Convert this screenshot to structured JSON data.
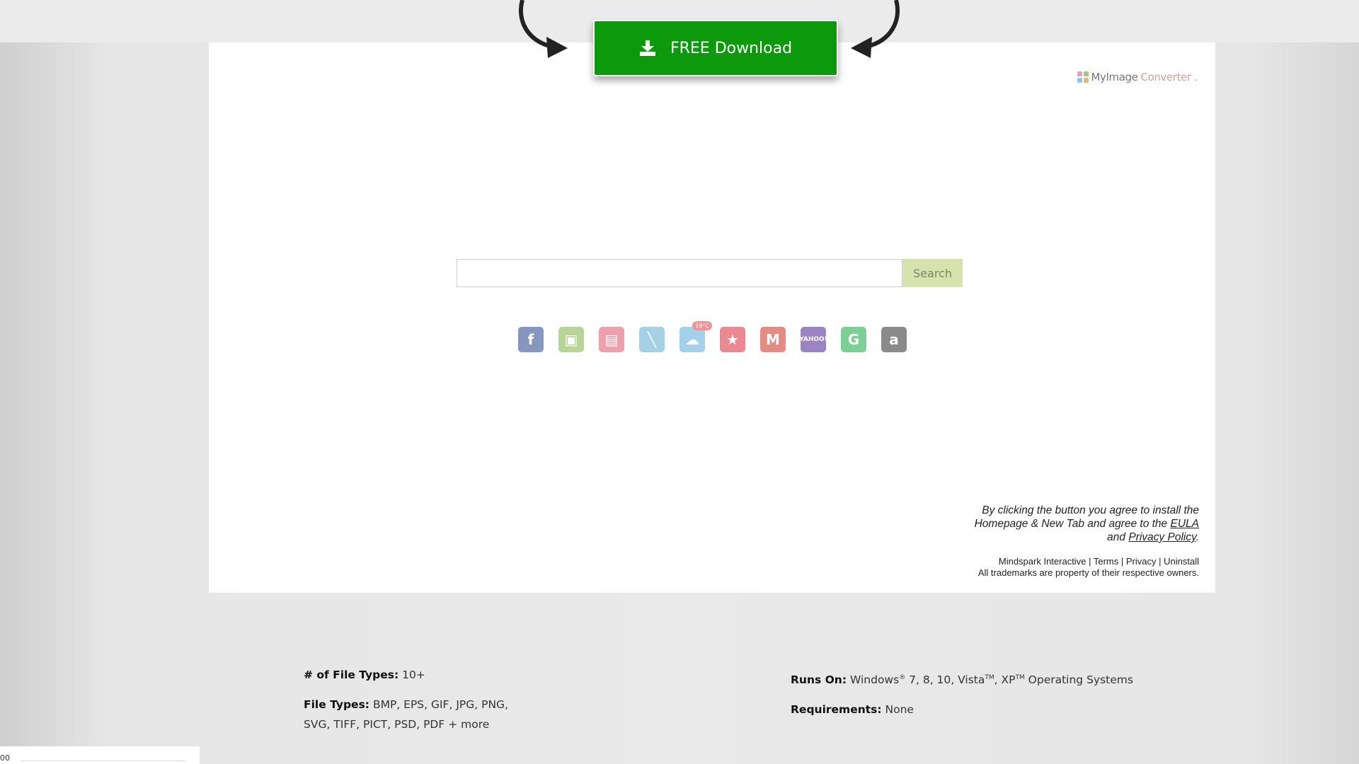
{
  "download": {
    "label": "FREE Download"
  },
  "logo": {
    "brand_a": "MyImage",
    "brand_b": "Converter",
    "dot": "."
  },
  "search": {
    "placeholder": "",
    "value": "",
    "button_label": "Search"
  },
  "quick_links": [
    {
      "name": "facebook",
      "glyph": "f",
      "color": "#3b5998"
    },
    {
      "name": "image-gallery",
      "glyph": "▣",
      "color": "#8dba57"
    },
    {
      "name": "photos",
      "glyph": "▤",
      "color": "#e3677a"
    },
    {
      "name": "notes",
      "glyph": "╲",
      "color": "#6fb6d9"
    },
    {
      "name": "weather",
      "glyph": "☁",
      "color": "#6cb4e0",
      "badge": "19°C"
    },
    {
      "name": "favorites",
      "glyph": "★",
      "color": "#e04050"
    },
    {
      "name": "gmail",
      "glyph": "M",
      "color": "#d44638"
    },
    {
      "name": "yahoo",
      "glyph": "YAHOO!",
      "color": "#5f3aa0"
    },
    {
      "name": "grammarly",
      "glyph": "G",
      "color": "#2db454"
    },
    {
      "name": "amazon",
      "glyph": "a",
      "color": "#444444"
    }
  ],
  "legal": {
    "line1": "By clicking the button you agree to install the",
    "line2": "Homepage & New Tab and agree to the",
    "eula": "EULA",
    "and": "and",
    "privacy_policy": "Privacy Policy",
    "period": "."
  },
  "footer": {
    "company": "Mindspark Interactive",
    "terms": "Terms",
    "privacy": "Privacy",
    "uninstall": "Uninstall",
    "sep": "|",
    "trademarks": "All trademarks are property of their respective owners."
  },
  "specs": {
    "file_types_count_label": "# of File Types:",
    "file_types_count_value": "10+",
    "file_types_label": "File Types:",
    "file_types_value_1": "BMP, EPS, GIF, JPG, PNG,",
    "file_types_value_2": "SVG, TIFF, PICT, PSD, PDF + more",
    "runs_on_label": "Runs On:",
    "runs_on_win": "Windows",
    "reg": "®",
    "runs_on_versions": "7, 8, 10, Vista",
    "tm": "TM",
    "runs_on_xp": ", XP",
    "runs_on_suffix": "Operating Systems",
    "requirements_label": "Requirements:",
    "requirements_value": "None"
  },
  "bottom_widget": {
    "number": "00"
  },
  "colors": {
    "download_green": "#0c9a0c",
    "search_button": "#d6e3ac"
  }
}
